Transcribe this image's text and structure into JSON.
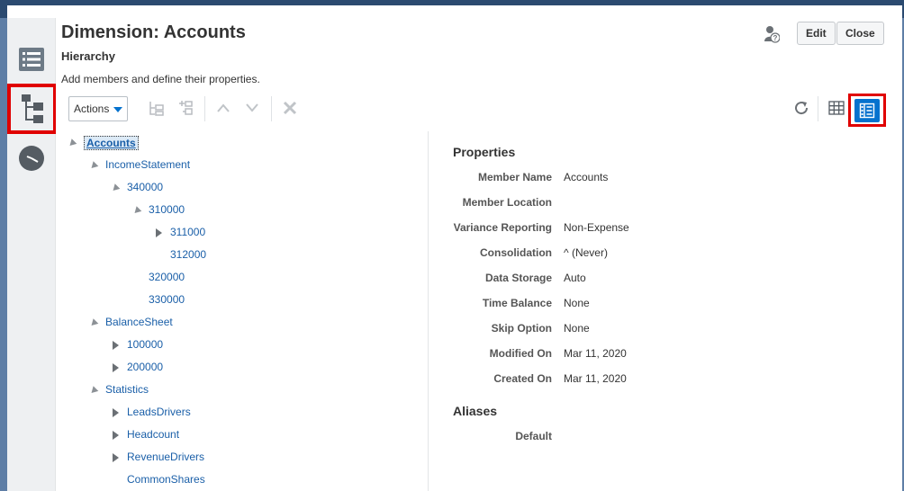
{
  "header": {
    "title": "Dimension: Accounts",
    "subtitle": "Hierarchy",
    "description": "Add members and define their properties.",
    "edit_label": "Edit",
    "close_label": "Close"
  },
  "toolbar": {
    "actions_label": "Actions"
  },
  "tree": [
    {
      "label": "Accounts",
      "level": 0,
      "state": "expanded",
      "selected": true
    },
    {
      "label": "IncomeStatement",
      "level": 1,
      "state": "expanded"
    },
    {
      "label": "340000",
      "level": 2,
      "state": "expanded"
    },
    {
      "label": "310000",
      "level": 3,
      "state": "expanded"
    },
    {
      "label": "311000",
      "level": 4,
      "state": "collapsed"
    },
    {
      "label": "312000",
      "level": 4,
      "state": "leaf"
    },
    {
      "label": "320000",
      "level": 3,
      "state": "leaf"
    },
    {
      "label": "330000",
      "level": 3,
      "state": "leaf"
    },
    {
      "label": "BalanceSheet",
      "level": 1,
      "state": "expanded"
    },
    {
      "label": "100000",
      "level": 2,
      "state": "collapsed"
    },
    {
      "label": "200000",
      "level": 2,
      "state": "collapsed"
    },
    {
      "label": "Statistics",
      "level": 1,
      "state": "expanded"
    },
    {
      "label": "LeadsDrivers",
      "level": 2,
      "state": "collapsed"
    },
    {
      "label": "Headcount",
      "level": 2,
      "state": "collapsed"
    },
    {
      "label": "RevenueDrivers",
      "level": 2,
      "state": "collapsed"
    },
    {
      "label": "CommonShares",
      "level": 2,
      "state": "leaf"
    }
  ],
  "properties": {
    "heading": "Properties",
    "rows": [
      {
        "label": "Member Name",
        "value": "Accounts"
      },
      {
        "label": "Member Location",
        "value": ""
      },
      {
        "label": "Variance Reporting",
        "value": "Non-Expense"
      },
      {
        "label": "Consolidation",
        "value": "^ (Never)"
      },
      {
        "label": "Data Storage",
        "value": "Auto"
      },
      {
        "label": "Time Balance",
        "value": "None"
      },
      {
        "label": "Skip Option",
        "value": "None"
      },
      {
        "label": "Modified On",
        "value": "Mar 11, 2020"
      },
      {
        "label": "Created On",
        "value": "Mar 11, 2020"
      }
    ]
  },
  "aliases": {
    "heading": "Aliases",
    "rows": [
      {
        "label": "Default",
        "value": ""
      }
    ]
  },
  "colors": {
    "accent": "#0572ce",
    "highlight_box": "#e00000",
    "link": "#1a5fa8"
  }
}
